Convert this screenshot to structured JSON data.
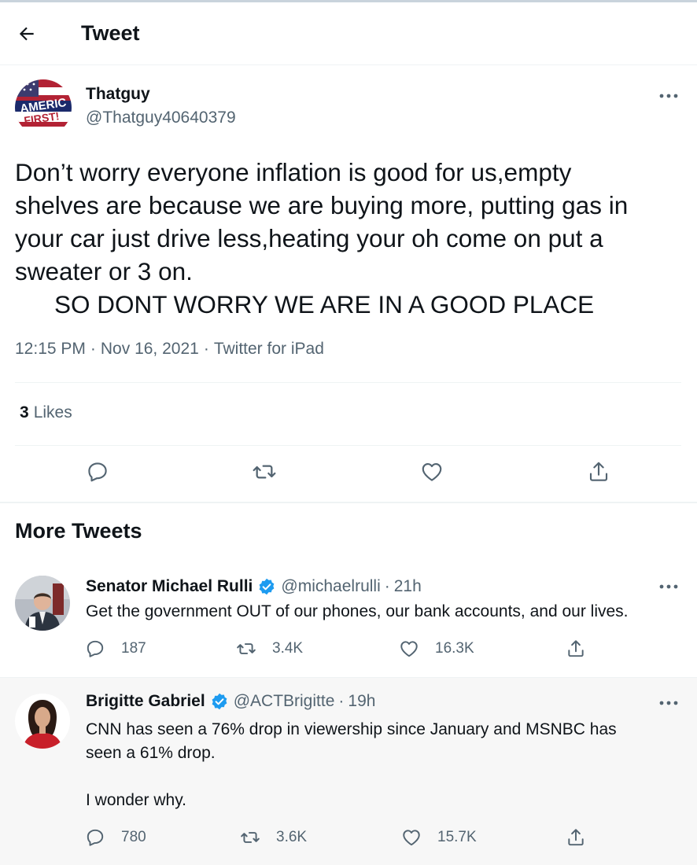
{
  "header": {
    "title": "Tweet"
  },
  "tweet": {
    "author_name": "Thatguy",
    "author_handle": "@Thatguy40640379",
    "avatar_text_line1": "AMERIC",
    "avatar_text_line2": "FIRST!",
    "text_lines": [
      "Don’t worry everyone inflation is good for us,empty",
      "shelves are because we are buying more, putting gas in",
      "your car just drive less,heating your oh come on put a",
      "sweater or 3 on.",
      "SO DONT WORRY WE ARE IN A GOOD PLACE"
    ],
    "time": "12:15 PM",
    "date": "Nov 16, 2021",
    "source": "Twitter for iPad",
    "separator": "·",
    "likes_count": "3",
    "likes_label": "Likes"
  },
  "more_tweets": {
    "title": "More Tweets",
    "items": [
      {
        "name": "Senator Michael Rulli",
        "handle": "@michaelrulli",
        "time": "21h",
        "body": [
          "Get the government OUT of our phones, our bank accounts, and our lives."
        ],
        "replies": "187",
        "retweets": "3.4K",
        "likes": "16.3K"
      },
      {
        "name": "Brigitte Gabriel",
        "handle": "@ACTBrigitte",
        "time": "19h",
        "body": [
          "CNN has seen a 76% drop in viewership since January and MSNBC has",
          "seen a 61% drop.",
          "",
          "I wonder why."
        ],
        "replies": "780",
        "retweets": "3.6K",
        "likes": "15.7K"
      }
    ]
  },
  "icons": {
    "back": "arrow-left-icon",
    "more": "more-dots-icon",
    "reply": "reply-icon",
    "retweet": "retweet-icon",
    "like": "heart-icon",
    "share": "share-icon",
    "verified": "verified-badge-icon"
  },
  "colors": {
    "text": "#0f1419",
    "secondary": "#536471",
    "verified": "#1d9bf0",
    "divider": "#eff3f4",
    "highlight_bg": "#f7f7f7"
  }
}
